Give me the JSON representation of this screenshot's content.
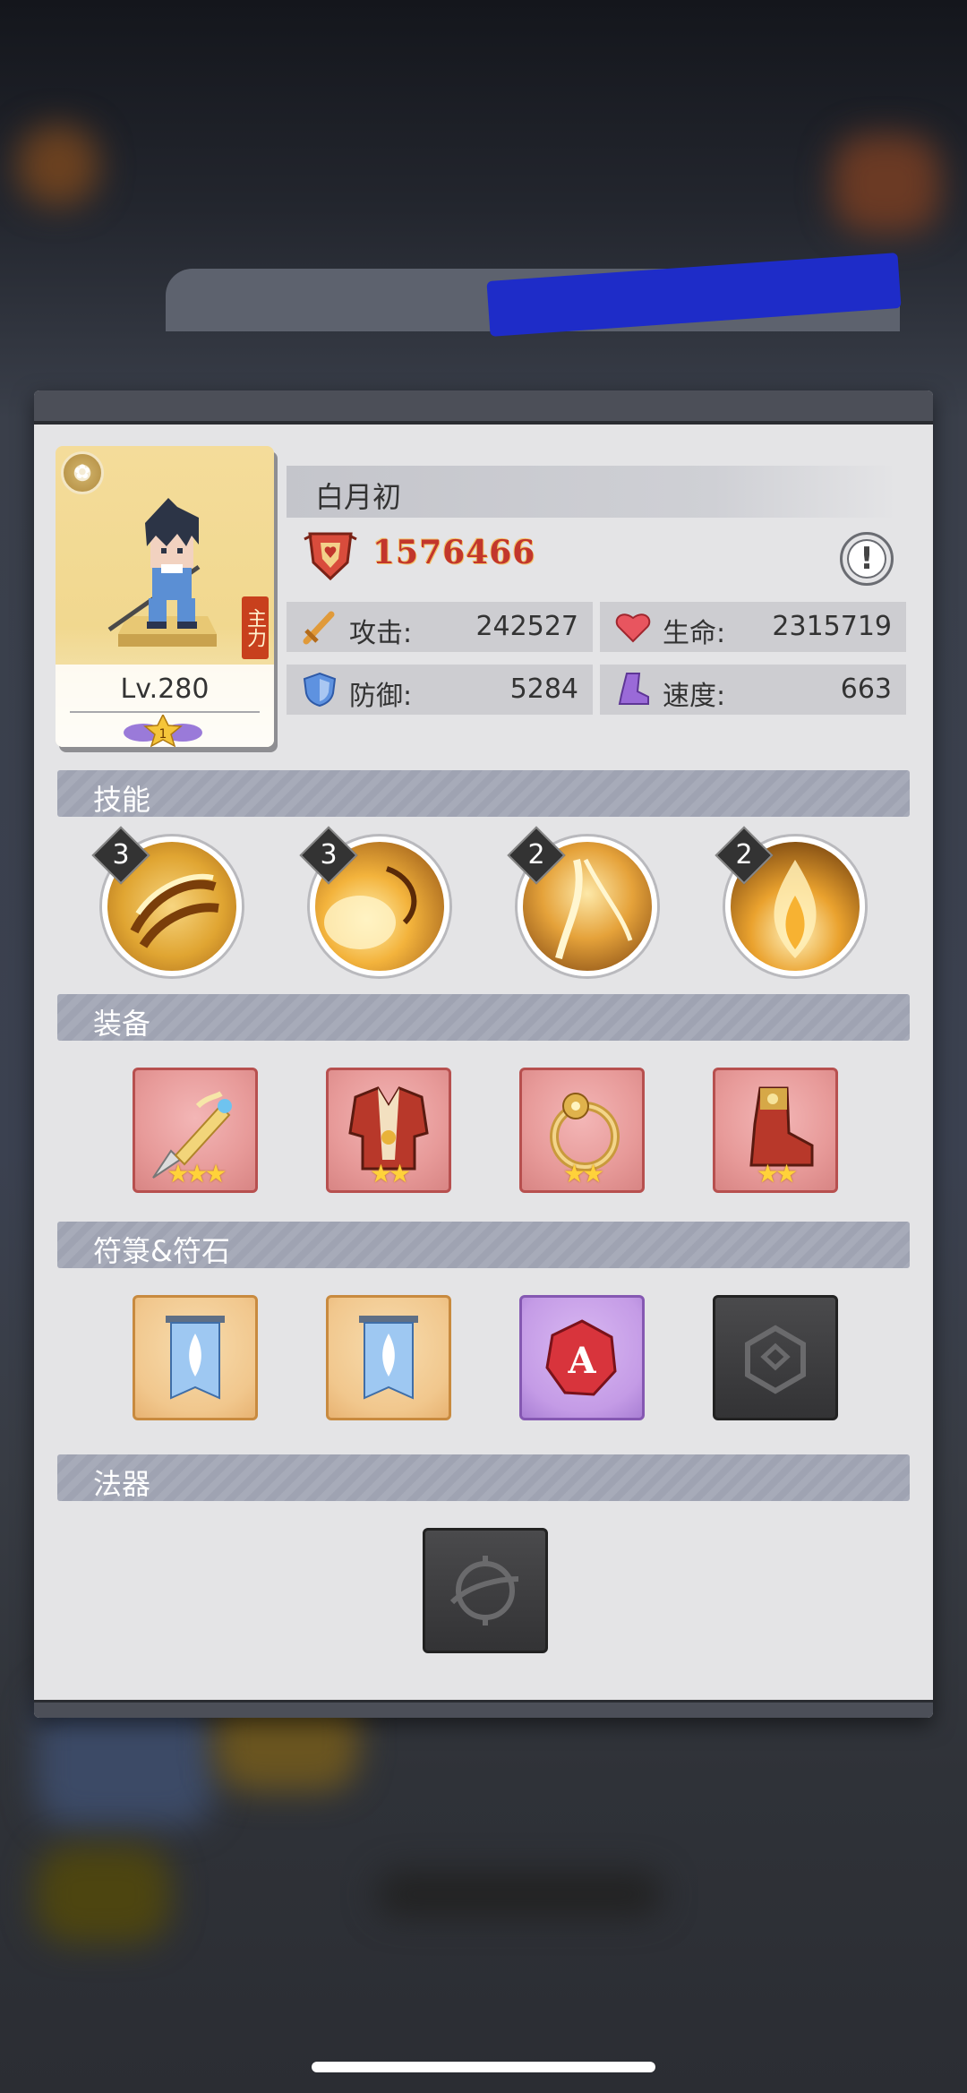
{
  "hero": {
    "level": "Lv.280",
    "star_rank": "1",
    "tag": "主力",
    "name": "白月初",
    "power": "1576466"
  },
  "stats": {
    "attack": {
      "label": "攻击:",
      "value": "242527",
      "icon": "sword-icon"
    },
    "hp": {
      "label": "生命:",
      "value": "2315719",
      "icon": "heart-icon"
    },
    "defense": {
      "label": "防御:",
      "value": "5284",
      "icon": "shield-icon"
    },
    "speed": {
      "label": "速度:",
      "value": "663",
      "icon": "boot-icon"
    }
  },
  "sections": {
    "skills": "技能",
    "equipment": "装备",
    "talismans": "符箓&符石",
    "artifact": "法器"
  },
  "skills": [
    {
      "level": "3"
    },
    {
      "level": "3"
    },
    {
      "level": "2"
    },
    {
      "level": "2"
    }
  ],
  "equipment": [
    {
      "name": "weapon",
      "stars": "★★★"
    },
    {
      "name": "armor",
      "stars": "★★"
    },
    {
      "name": "ring",
      "stars": "★★"
    },
    {
      "name": "boots",
      "stars": "★★"
    }
  ],
  "colors": {
    "power_red": "#c2362c",
    "section_header": "#a7abb9",
    "dialog_bg": "#e4e4e6"
  }
}
